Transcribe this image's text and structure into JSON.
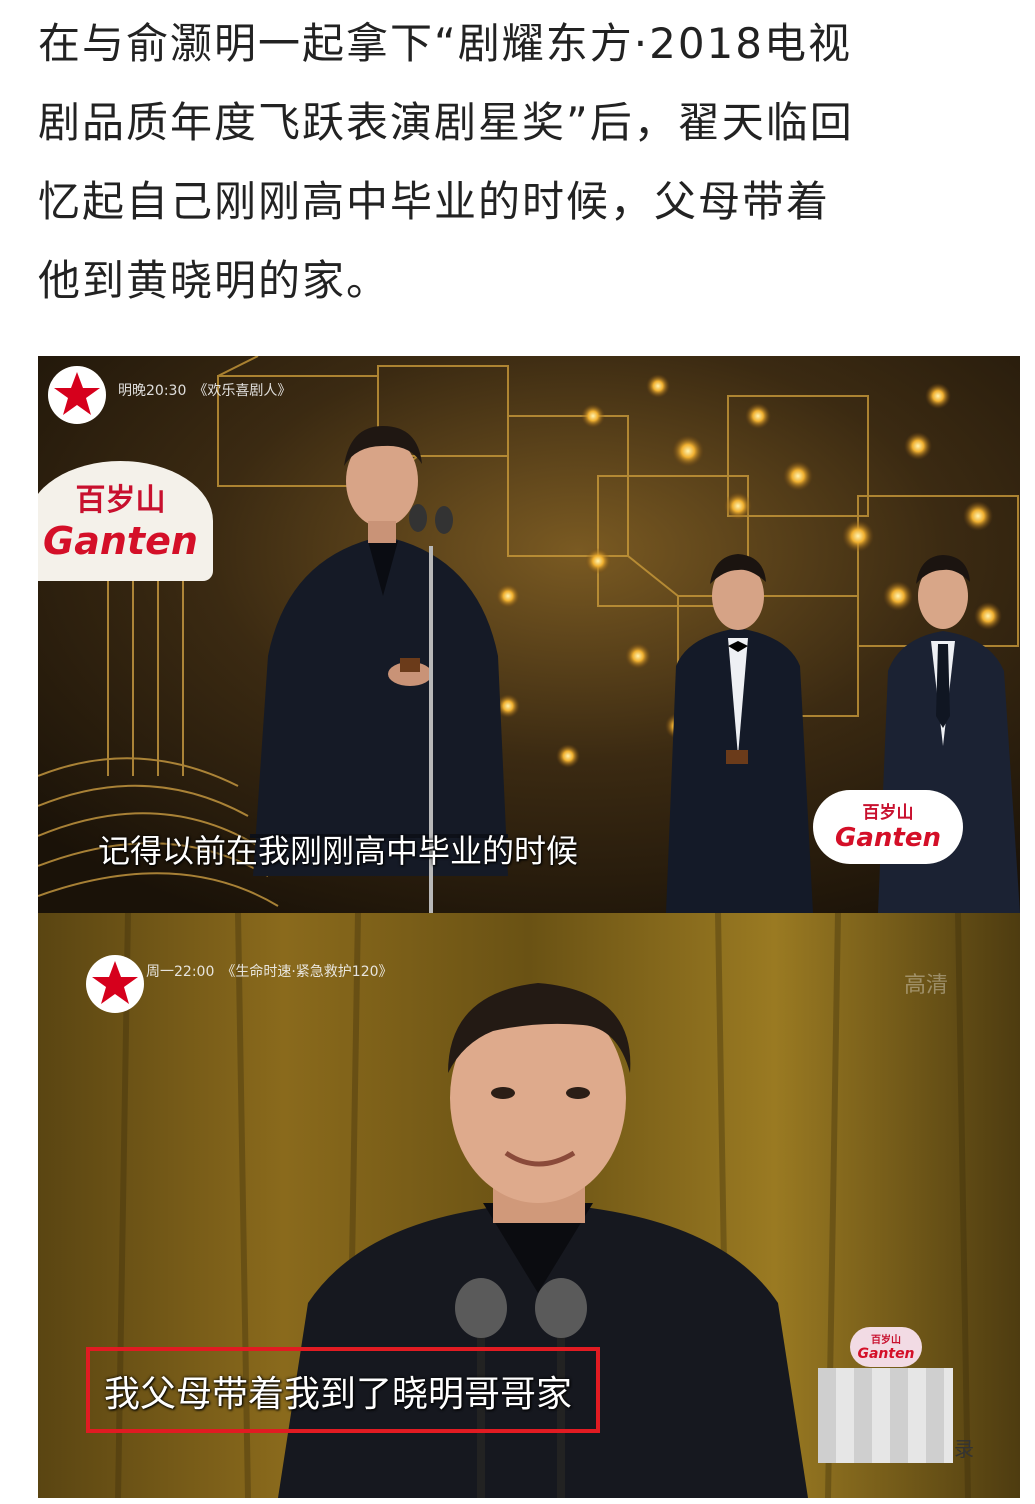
{
  "article": {
    "lines": [
      "在与俞灏明一起拿下“剧耀东方·2018电视",
      "剧品质年度飞跃表演剧星奖”后，翟天临回",
      "忆起自己刚刚高中毕业的时候，父母带着",
      "他到黄晓明的家。"
    ]
  },
  "frame1": {
    "channel_info": "明晚20:30　《欢乐喜剧人》",
    "sponsor_cn": "百岁山",
    "sponsor_en": "Ganten",
    "sponsor_cn_2": "百岁山",
    "sponsor_en_2": "Ganten",
    "subtitle": "记得以前在我刚刚高中毕业的时候"
  },
  "frame2": {
    "channel_info": "周一22:00　《生命时速·紧急救护120》",
    "watermark": "高清",
    "subtitle": "我父母带着我到了晓明哥哥家",
    "sponsor_cn": "百岁山",
    "sponsor_en": "Ganten",
    "corner_mark": "录"
  },
  "colors": {
    "highlight_box": "#e11b22",
    "channel_star": "#d6001c"
  }
}
